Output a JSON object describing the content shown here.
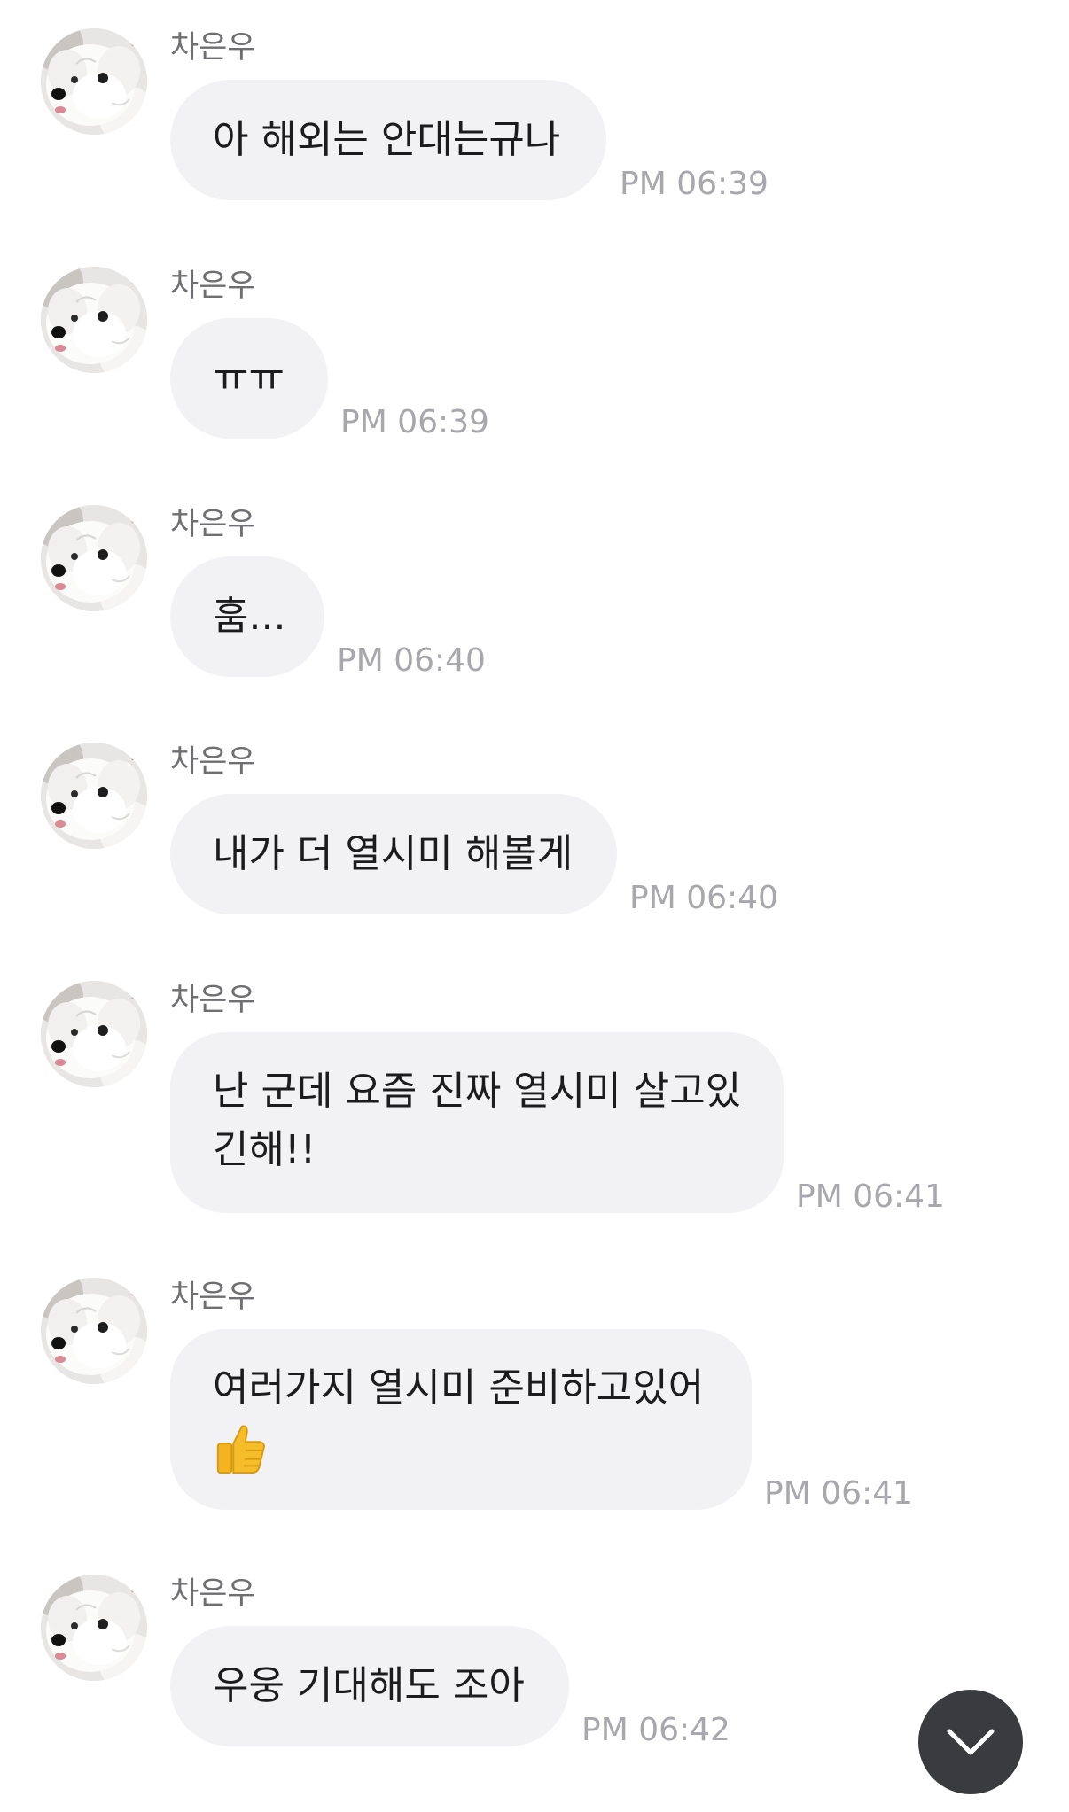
{
  "messages": [
    {
      "sender": "차은우",
      "text": "아 해외는 안대는규나",
      "time": "PM 06:39"
    },
    {
      "sender": "차은우",
      "text": "ㅠㅠ",
      "time": "PM 06:39"
    },
    {
      "sender": "차은우",
      "text": "훔...",
      "time": "PM 06:40"
    },
    {
      "sender": "차은우",
      "text": "내가 더 열시미 해볼게",
      "time": "PM 06:40"
    },
    {
      "sender": "차은우",
      "text_line1": "난 군데 요즘 진짜 열시미 살고있",
      "text_line2": "긴해!!",
      "time": "PM 06:41"
    },
    {
      "sender": "차은우",
      "text_line1": "여러가지 열시미 준비하고있어",
      "emoji": "thumbs-up-icon",
      "time": "PM 06:41"
    },
    {
      "sender": "차은우",
      "text": "우웅 기대해도 조아",
      "time": "PM 06:42"
    }
  ],
  "scroll_button": {
    "icon": "chevron-down-icon"
  },
  "colors": {
    "bubble": "#f2f2f4",
    "time": "#a7a7ad",
    "name": "#6e6e73",
    "scroll_button": "#3a3b3f"
  }
}
